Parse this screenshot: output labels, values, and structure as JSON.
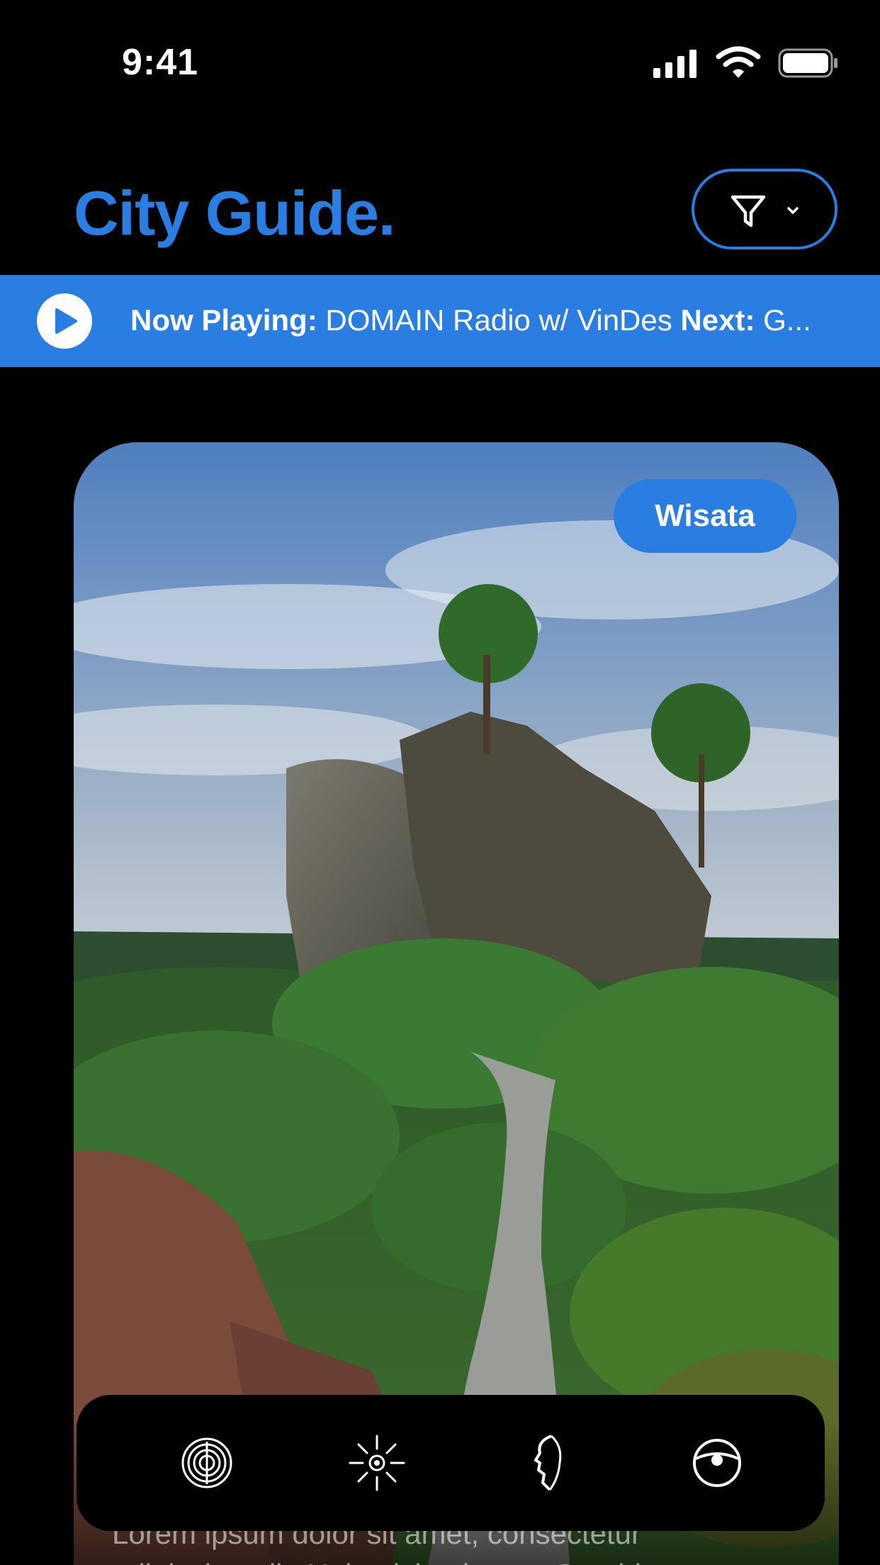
{
  "status_bar": {
    "time": "9:41"
  },
  "header": {
    "title": "City Guide.",
    "filter_icon": "filter-funnel-icon"
  },
  "now_playing": {
    "label": "Now Playing:",
    "current": " DOMAIN Radio w/ VinDes ",
    "next_label": "Next:",
    "next": " G..."
  },
  "card": {
    "badge": "Wisata",
    "text_line1": "Lorem ipsum dolor sit amet, consectetur",
    "text_line2": "adipiscing elit. Ut in nisl et lorem. Curabitur"
  },
  "toolbar": {
    "icons": [
      "concentric-circles-icon",
      "sun-icon",
      "face-profile-icon",
      "eye-icon"
    ]
  },
  "colors": {
    "accent": "#2a7de1",
    "background": "#000000"
  }
}
